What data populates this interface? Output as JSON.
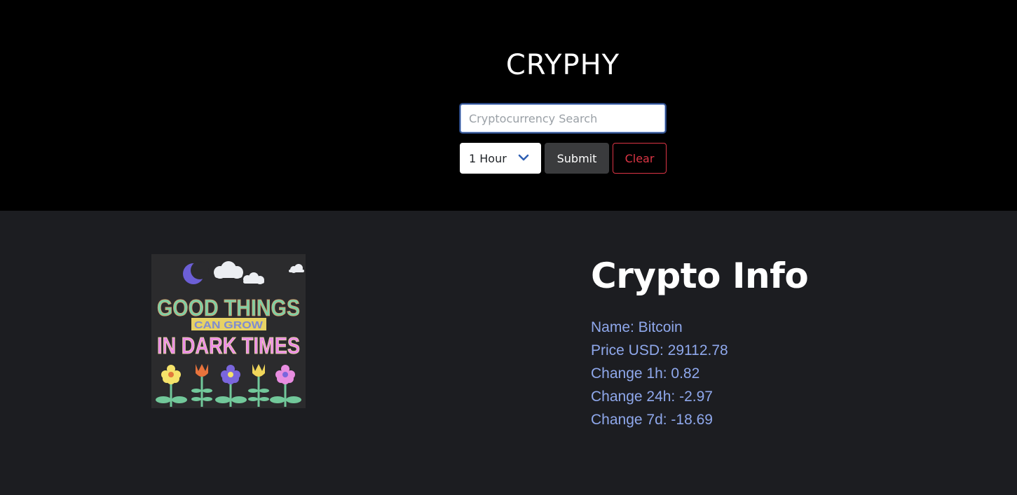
{
  "app": {
    "title": "CRYPHY"
  },
  "search": {
    "placeholder": "Cryptocurrency Search",
    "value": ""
  },
  "timeframe": {
    "selected": "1 Hour"
  },
  "buttons": {
    "submit_label": "Submit",
    "clear_label": "Clear"
  },
  "artwork": {
    "line1": "GOOD THINGS",
    "line2": "CAN GROW",
    "line3": "IN DARK TIMES"
  },
  "info": {
    "heading": "Crypto Info",
    "name": "Name: Bitcoin",
    "price": "Price USD: 29112.78",
    "change_1h": "Change 1h: 0.82",
    "change_24h": "Change 24h: -2.97",
    "change_7d": "Change 7d: -18.69"
  },
  "colors": {
    "header_bg": "#000000",
    "body_bg": "#1c1d21",
    "info_text": "#8fa8ec",
    "danger": "#dc3545"
  },
  "icons": {
    "select_caret": "chevron-down-icon"
  }
}
